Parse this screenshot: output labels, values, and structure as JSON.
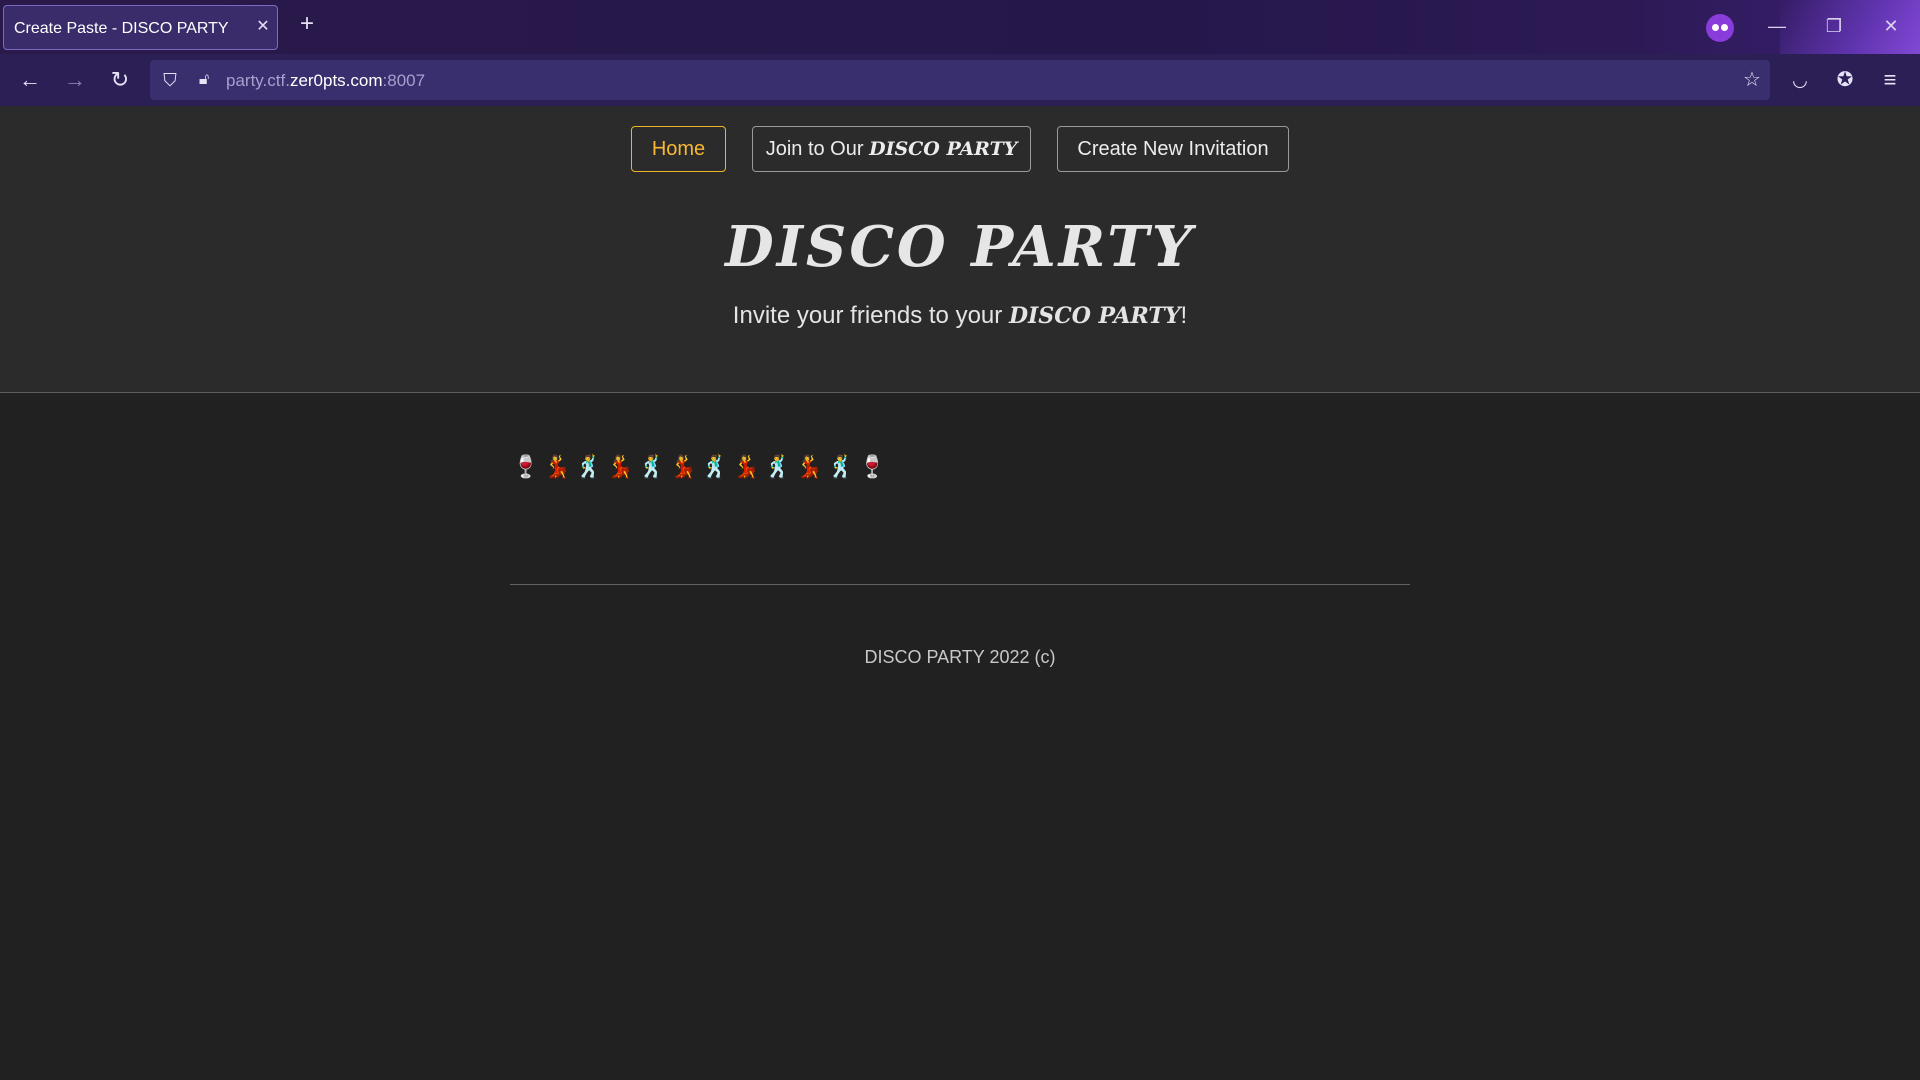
{
  "browser": {
    "tab_title": "Create Paste - DISCO PARTY",
    "url_prefix": "party.ctf.",
    "url_host": "zer0pts.com",
    "url_suffix": ":8007",
    "icons": [
      "back-icon",
      "forward-icon",
      "reload-icon",
      "shield-icon",
      "lock-icon",
      "bookmark-star-icon",
      "pocket-icon",
      "extensions-icon",
      "menu-icon",
      "private-browsing-icon"
    ]
  },
  "nav": {
    "home_label": "Home",
    "join_label": "Join to Our ",
    "join_brand": "DISCO PARTY",
    "create_label": "Create New Invitation"
  },
  "hero": {
    "title": "DISCO PARTY",
    "subtitle_prefix": "Invite your friends to your ",
    "subtitle_brand": "DISCO PARTY",
    "subtitle_suffix": "!"
  },
  "content": {
    "emojis": [
      "🍷",
      "💃",
      "🕺",
      "💃",
      "🕺",
      "💃",
      "🕺",
      "💃",
      "🕺",
      "💃",
      "🕺",
      "🍷"
    ]
  },
  "footer": {
    "text": "DISCO PARTY 2022 (c)"
  },
  "colors": {
    "active_accent": "#f0b429",
    "page_bg": "#212121",
    "hero_bg": "#2b2b2b",
    "chrome_bg": "#2b1f55"
  }
}
